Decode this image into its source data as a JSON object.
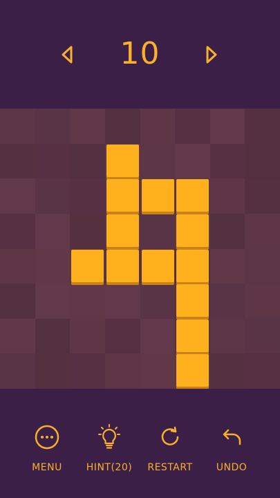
{
  "header": {
    "level": "10",
    "prev_icon": "triangle-left-icon",
    "next_icon": "triangle-right-icon"
  },
  "colors": {
    "background": "#3c1f47",
    "board": "#5a3446",
    "accent": "#f7b12a",
    "tile": "#feb01d",
    "tile_shadow": "#c9821a"
  },
  "board": {
    "grid_size": 8,
    "tiles": [
      {
        "row": 1,
        "col": 3
      },
      {
        "row": 2,
        "col": 3
      },
      {
        "row": 2,
        "col": 4
      },
      {
        "row": 2,
        "col": 5
      },
      {
        "row": 3,
        "col": 3
      },
      {
        "row": 3,
        "col": 5
      },
      {
        "row": 4,
        "col": 2
      },
      {
        "row": 4,
        "col": 3
      },
      {
        "row": 4,
        "col": 4
      },
      {
        "row": 4,
        "col": 5
      },
      {
        "row": 5,
        "col": 5
      },
      {
        "row": 6,
        "col": 5
      },
      {
        "row": 7,
        "col": 5
      }
    ]
  },
  "footer": {
    "buttons": [
      {
        "label": "MENU",
        "icon": "menu-dots-icon"
      },
      {
        "label": "HINT(20)",
        "icon": "lightbulb-icon"
      },
      {
        "label": "RESTART",
        "icon": "restart-icon"
      },
      {
        "label": "UNDO",
        "icon": "undo-icon"
      }
    ]
  }
}
